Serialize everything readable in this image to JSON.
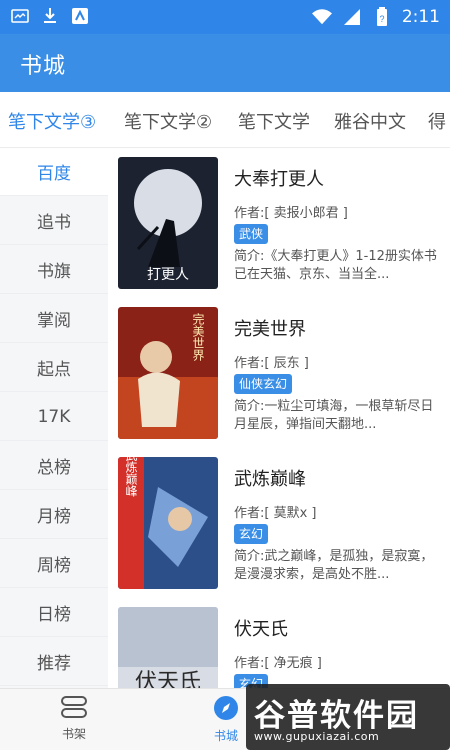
{
  "status_bar": {
    "time": "2:11",
    "icons": [
      "notification-icon",
      "download-icon",
      "app-icon",
      "wifi-icon",
      "battery-icon",
      "signal-icon"
    ]
  },
  "app_bar": {
    "title": "书城"
  },
  "source_tabs": [
    {
      "label": "笔下文学③",
      "active": true
    },
    {
      "label": "笔下文学②"
    },
    {
      "label": "笔下文学"
    },
    {
      "label": "雅谷中文"
    },
    {
      "label": "得"
    }
  ],
  "sidebar": [
    {
      "label": "百度",
      "active": true
    },
    {
      "label": "追书"
    },
    {
      "label": "书旗"
    },
    {
      "label": "掌阅"
    },
    {
      "label": "起点"
    },
    {
      "label": "17K"
    },
    {
      "label": "总榜"
    },
    {
      "label": "月榜"
    },
    {
      "label": "周榜"
    },
    {
      "label": "日榜"
    },
    {
      "label": "推荐"
    }
  ],
  "books": [
    {
      "title": "大奉打更人",
      "author": "作者:[ 卖报小郎君 ]",
      "tag": "武侠",
      "intro": "简介:《大奉打更人》1-12册实体书已在天猫、京东、当当全...",
      "cover_text": "打更人"
    },
    {
      "title": "完美世界",
      "author": "作者:[ 辰东 ]",
      "tag": "仙侠玄幻",
      "intro": "简介:一粒尘可填海，一根草斩尽日月星辰，弹指间天翻地...",
      "cover_text": "完美世界"
    },
    {
      "title": "武炼巅峰",
      "author": "作者:[ 莫默x ]",
      "tag": "玄幻",
      "intro": "简介:武之巅峰，是孤独，是寂寞，是漫漫求索，是高处不胜...",
      "cover_text": "武炼巅峰"
    },
    {
      "title": "伏天氏",
      "author": "作者:[ 净无痕 ]",
      "tag": "玄幻",
      "intro": "",
      "cover_text": "伏天氏"
    }
  ],
  "bottom_nav": [
    {
      "label": "书架",
      "icon": "bookshelf-icon"
    },
    {
      "label": "书城",
      "icon": "compass-icon",
      "active": true
    }
  ],
  "watermark": {
    "logo": "谷普软件园",
    "url": "www.gupuxiazai.com"
  },
  "colors": {
    "primary": "#3a8ee6",
    "status_bar": "#2f86e8",
    "sidebar_bg": "#f5f6f8"
  }
}
